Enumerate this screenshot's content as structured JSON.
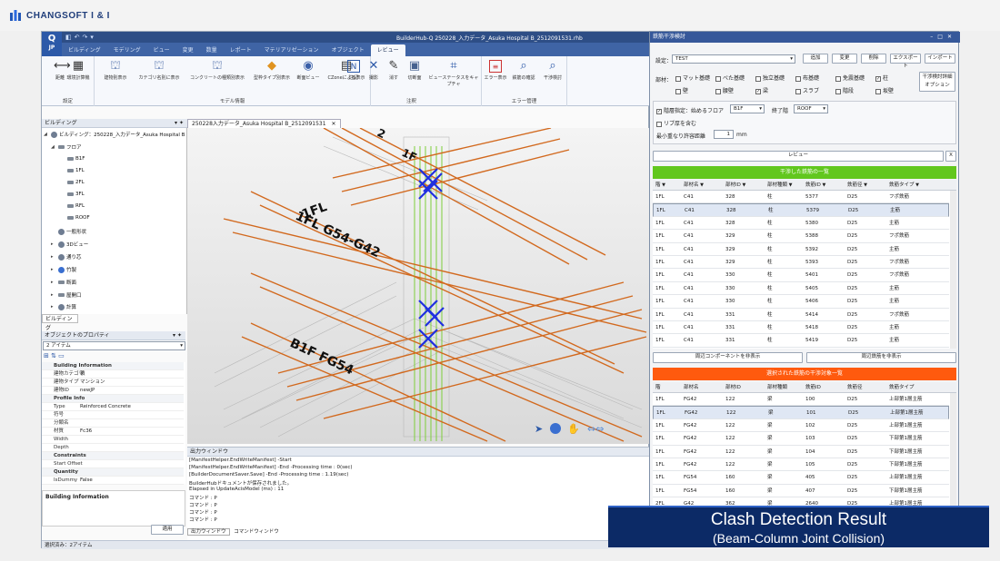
{
  "brand": {
    "name": "CHANGSOFT I & I"
  },
  "app": {
    "title": "BuilderHub-Q 250228_入力データ_Asuka Hospital B_2512091531.rhb",
    "logo": "Q",
    "logo_sub": "JP",
    "tabs": [
      "ビルディング",
      "モデリング",
      "ビュー",
      "変更",
      "数量",
      "レポート",
      "マテリアリゼーション",
      "オブジェクト",
      "レビュー"
    ],
    "ribbon": {
      "groups": [
        {
          "label": "設定",
          "buttons": [
            "距離",
            "環境計算機"
          ]
        },
        {
          "label": "モデル情報",
          "buttons": [
            "建物別表示",
            "カテゴリ名別に表示",
            "コンクリートの種類別表示",
            "型枠タイプ別表示",
            "断面ビュー",
            "CZoneによる表示"
          ]
        },
        {
          "label": "注釈",
          "buttons": [
            "注記",
            "撮影",
            "消す",
            "切断面",
            "ビューステータスをキャプチャ"
          ]
        },
        {
          "label": "エラー管理",
          "buttons": [
            "エラー表示",
            "鉄筋の確認",
            "干渉検討"
          ]
        }
      ]
    },
    "tree": {
      "header": "ビルディング",
      "items": [
        "ビルディング：250228_入力データ_Asuka Hospital B",
        "フロア",
        "B1F",
        "1FL",
        "2FL",
        "3FL",
        "RFL",
        "ROOF",
        "一般形状",
        "3Dビュー",
        "通り芯",
        "竹製",
        "断面",
        "屋開口",
        "計算"
      ],
      "footer_tab": "ビルディング"
    },
    "props": {
      "header": "オブジェクトのプロパティ",
      "count": "2 アイテム",
      "rows": [
        {
          "k": "Building Information",
          "v": "",
          "sec": true
        },
        {
          "k": "建物カテゴリ",
          "v": "積"
        },
        {
          "k": "建物タイプ",
          "v": "マンション"
        },
        {
          "k": "建物ID",
          "v": "newJP"
        },
        {
          "k": "Profile Info",
          "v": "",
          "sec": true
        },
        {
          "k": "Type",
          "v": "Reinforced Concrete"
        },
        {
          "k": "符号",
          "v": ""
        },
        {
          "k": "分類名",
          "v": ""
        },
        {
          "k": "材質",
          "v": "Fc36"
        },
        {
          "k": "Width",
          "v": ""
        },
        {
          "k": "Depth",
          "v": ""
        },
        {
          "k": "Constraints",
          "v": "",
          "sec": true
        },
        {
          "k": "Start Offset",
          "v": ""
        },
        {
          "k": "Quantity",
          "v": "",
          "sec": true
        },
        {
          "k": "IsDummy",
          "v": "False"
        }
      ],
      "footer": "Building Information",
      "apply": "適用"
    },
    "doc_tab": "250228入力データ_Asuka Hospital B_2512091531",
    "viewport_labels": {
      "a": "1FL G54-G42",
      "b": "B1F FG54",
      "c": "1FL",
      "d": "2",
      "e": "1F"
    },
    "output": {
      "header": "出力ウィンドウ",
      "lines": [
        "[ManifestHelper.EndWriteManifest] -Start",
        "[ManifestHelper.EndWriteManifest] -End -Processing time : 0(sec)",
        "[BuilderDocumentSaver.Save] -End -Processing time : 1.19(sec)",
        "BuilderHubドキュメントが保存されました。",
        "Elapsed in UpdateAcisModel (ms) : 11",
        "コマンド : P",
        "コマンド : P",
        "コマンド : P",
        "コマンド : P"
      ],
      "tabs": [
        "出力ウィンドウ",
        "コマンドウィンドウ"
      ]
    },
    "status": "選択済み：2アイテム"
  },
  "dialog": {
    "title": "鉄筋干渉検討",
    "setting_label": "設定：",
    "setting_value": "TEST",
    "buttons": [
      "追加",
      "変更",
      "削除",
      "エクスポート",
      "インポート"
    ],
    "member_label": "部材：",
    "members_row1": [
      {
        "t": "マット基礎",
        "c": false
      },
      {
        "t": "べた基礎",
        "c": false
      },
      {
        "t": "独立基礎",
        "c": false
      },
      {
        "t": "布基礎",
        "c": false
      },
      {
        "t": "免震基礎",
        "c": false
      },
      {
        "t": "柱",
        "c": true
      }
    ],
    "members_row2": [
      {
        "t": "壁",
        "c": false
      },
      {
        "t": "腰壁",
        "c": false
      },
      {
        "t": "梁",
        "c": true
      },
      {
        "t": "スラブ",
        "c": false
      },
      {
        "t": "階段",
        "c": false
      },
      {
        "t": "坂壁",
        "c": false
      }
    ],
    "detail_btn": "干渉検討詳細オプション",
    "floor_label": "階層指定：始めるフロア",
    "floor_from": "B1F",
    "floor_to_label": "終了階",
    "floor_to": "ROOF",
    "rib_label": "リブ厚を含む",
    "tol_label": "最小重なり許容距離",
    "tol_value": "1",
    "tol_unit": "mm",
    "review": "レビュー",
    "close_x": "X",
    "list1_title": "干渉した鉄筋の一覧",
    "cols1": [
      "階",
      "部材名",
      "部材ID",
      "部材種類",
      "鉄筋ID",
      "鉄筋径",
      "鉄筋タイプ"
    ],
    "rows1": [
      [
        "1FL",
        "C41",
        "328",
        "柱",
        "5377",
        "D25",
        "フポ鉄筋"
      ],
      [
        "1FL",
        "C41",
        "328",
        "柱",
        "5379",
        "D25",
        "主筋"
      ],
      [
        "1FL",
        "C41",
        "328",
        "柱",
        "5380",
        "D25",
        "主筋"
      ],
      [
        "1FL",
        "C41",
        "329",
        "柱",
        "5388",
        "D25",
        "フポ鉄筋"
      ],
      [
        "1FL",
        "C41",
        "329",
        "柱",
        "5392",
        "D25",
        "主筋"
      ],
      [
        "1FL",
        "C41",
        "329",
        "柱",
        "5393",
        "D25",
        "フポ鉄筋"
      ],
      [
        "1FL",
        "C41",
        "330",
        "柱",
        "5401",
        "D25",
        "フポ鉄筋"
      ],
      [
        "1FL",
        "C41",
        "330",
        "柱",
        "5405",
        "D25",
        "主筋"
      ],
      [
        "1FL",
        "C41",
        "330",
        "柱",
        "5406",
        "D25",
        "主筋"
      ],
      [
        "1FL",
        "C41",
        "331",
        "柱",
        "5414",
        "D25",
        "フポ鉄筋"
      ],
      [
        "1FL",
        "C41",
        "331",
        "柱",
        "5418",
        "D25",
        "主筋"
      ],
      [
        "1FL",
        "C41",
        "331",
        "柱",
        "5419",
        "D25",
        "主筋"
      ]
    ],
    "sub_btns": [
      "周辺コンポーネントを非表示",
      "周辺鉄筋を非表示"
    ],
    "list2_title": "選択された鉄筋の干渉対象一覧",
    "cols2": [
      "階",
      "部材名",
      "部材ID",
      "部材種類",
      "鉄筋ID",
      "鉄筋径",
      "鉄筋タイプ"
    ],
    "rows2": [
      [
        "1FL",
        "FG42",
        "122",
        "梁",
        "100",
        "D25",
        "上部第1層主筋"
      ],
      [
        "1FL",
        "FG42",
        "122",
        "梁",
        "101",
        "D25",
        "上部第1層主筋"
      ],
      [
        "1FL",
        "FG42",
        "122",
        "梁",
        "102",
        "D25",
        "上部第1層主筋"
      ],
      [
        "1FL",
        "FG42",
        "122",
        "梁",
        "103",
        "D25",
        "下部第1層主筋"
      ],
      [
        "1FL",
        "FG42",
        "122",
        "梁",
        "104",
        "D25",
        "下部第1層主筋"
      ],
      [
        "1FL",
        "FG42",
        "122",
        "梁",
        "105",
        "D25",
        "下部第1層主筋"
      ],
      [
        "1FL",
        "FG54",
        "160",
        "梁",
        "405",
        "D25",
        "上部第1層主筋"
      ],
      [
        "1FL",
        "FG54",
        "160",
        "梁",
        "407",
        "D25",
        "下部第1層主筋"
      ],
      [
        "2FL",
        "G42",
        "362",
        "梁",
        "2640",
        "D25",
        "上部第1層主筋"
      ]
    ]
  },
  "caption": {
    "line1": "Clash Detection Result",
    "line2": "(Beam-Column Joint Collision)"
  },
  "colors": {
    "green": "#62c71e",
    "orange": "#ff5a0e",
    "rebar": "#d2691e",
    "clash": "#1f2fe0",
    "column_bar": "#7dce3a"
  }
}
